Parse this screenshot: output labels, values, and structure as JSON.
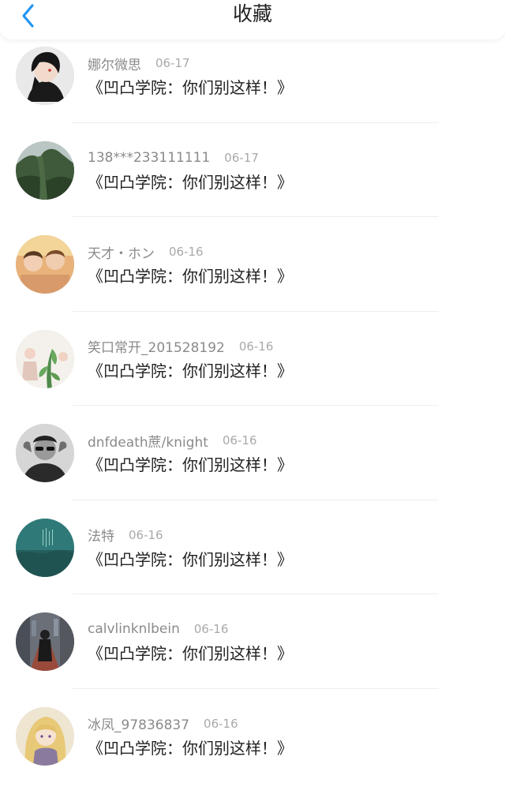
{
  "header": {
    "title": "收藏",
    "back_icon": "chevron-left-icon",
    "accent_color": "#2196f3"
  },
  "favorites": [
    {
      "username": "娜尔微思",
      "date": "06-17",
      "title": "《凹凸学院：你们别这样！》"
    },
    {
      "username": "138***233111111",
      "date": "06-17",
      "title": "《凹凸学院：你们别这样！》"
    },
    {
      "username": "天才・ホン",
      "date": "06-16",
      "title": "《凹凸学院：你们别这样！》"
    },
    {
      "username": "笑口常开_201528192",
      "date": "06-16",
      "title": "《凹凸学院：你们别这样！》"
    },
    {
      "username": "dnfdeath蔗/knight",
      "date": "06-16",
      "title": "《凹凸学院：你们别这样！》"
    },
    {
      "username": "法特",
      "date": "06-16",
      "title": "《凹凸学院：你们别这样！》"
    },
    {
      "username": "calvlinknlbein",
      "date": "06-16",
      "title": "《凹凸学院：你们别这样！》"
    },
    {
      "username": "冰凤_97836837",
      "date": "06-16",
      "title": "《凹凸学院：你们别这样！》"
    }
  ]
}
